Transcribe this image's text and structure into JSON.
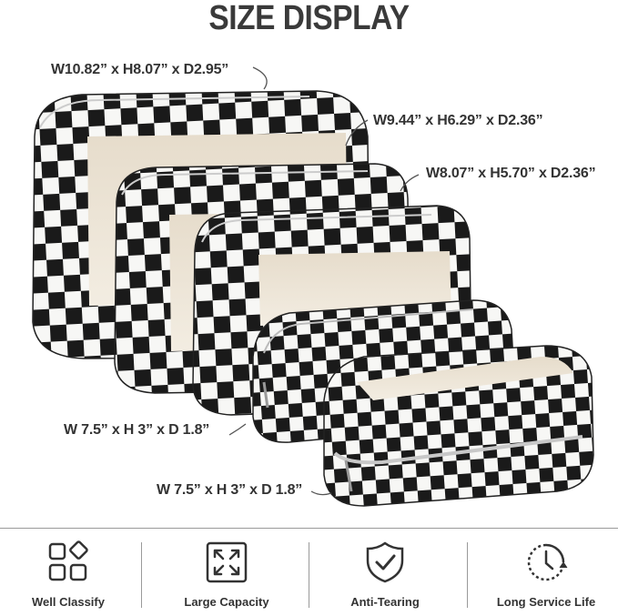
{
  "title": "SIZE DISPLAY",
  "dimensions": [
    "W10.82” x H8.07” x D2.95”",
    "W9.44” x H6.29” x D2.36”",
    "W8.07” x H5.70” x D2.36”",
    "W 7.5” x H 3” x D 1.8”",
    "W 7.5” x H 3” x D 1.8”"
  ],
  "features": [
    {
      "label": "Well Classify",
      "icon": "grid-shapes-icon"
    },
    {
      "label": "Large Capacity",
      "icon": "expand-arrows-icon"
    },
    {
      "label": "Anti-Tearing",
      "icon": "shield-check-icon"
    },
    {
      "label": "Long Service Life",
      "icon": "clock-icon"
    }
  ],
  "colors": {
    "checker_dark": "#1a1a1a",
    "checker_light": "#f7f7f5",
    "lining": "#ece2d3",
    "text": "#333333"
  }
}
